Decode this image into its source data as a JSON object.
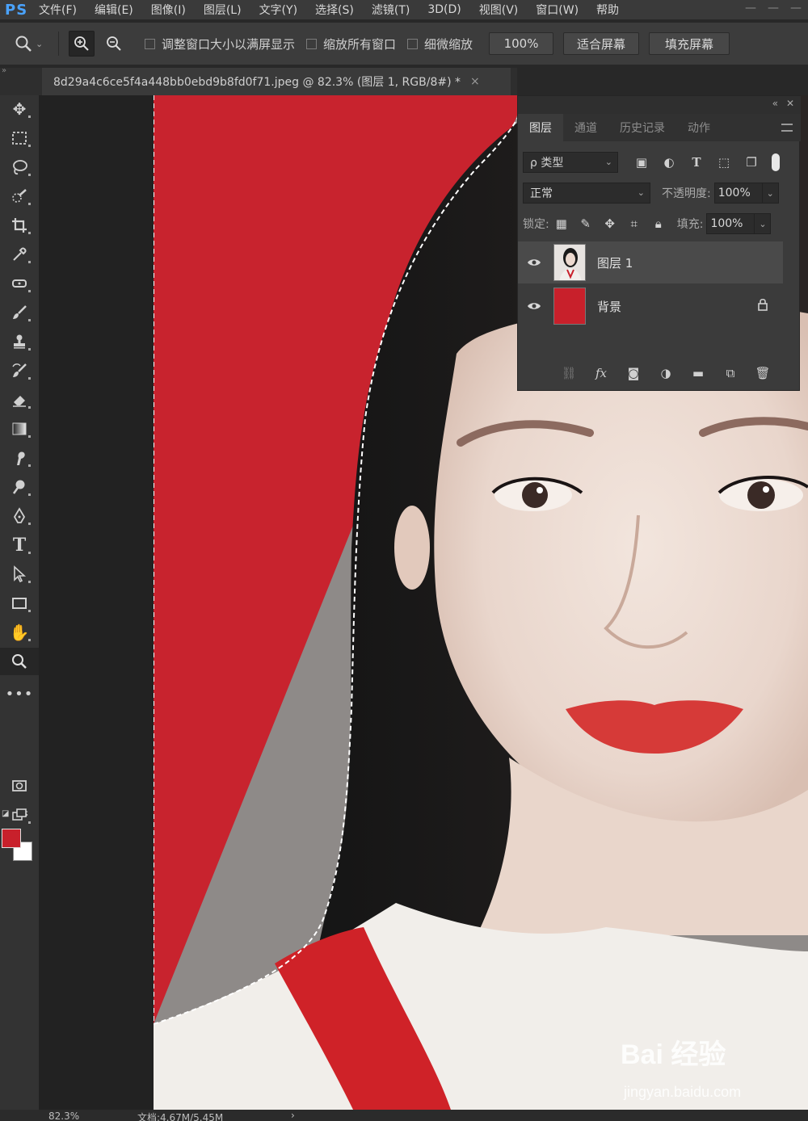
{
  "app": {
    "logo": "PS"
  },
  "menu": [
    "文件(F)",
    "编辑(E)",
    "图像(I)",
    "图层(L)",
    "文字(Y)",
    "选择(S)",
    "滤镜(T)",
    "3D(D)",
    "视图(V)",
    "窗口(W)",
    "帮助"
  ],
  "options": {
    "check_resize": "调整窗口大小以满屏显示",
    "check_zoom_all": "缩放所有窗口",
    "check_scrubby": "细微缩放",
    "zoom_value": "100%",
    "fit_screen": "适合屏幕",
    "fill_screen": "填充屏幕"
  },
  "document": {
    "tab_title": "8d29a4c6ce5f4a448bb0ebd9b8fd0f71.jpeg @ 82.3% (图层 1, RGB/8#) *",
    "close": "×"
  },
  "status": {
    "zoom": "82.3%",
    "doc_info": "文档:4.67M/5.45M",
    "arrow": "›"
  },
  "colors": {
    "foreground": "#c8202b",
    "background": "#ffffff",
    "canvas_red": "#c8232e"
  },
  "layers_panel": {
    "tabs": [
      "图层",
      "通道",
      "历史记录",
      "动作"
    ],
    "active_tab": 0,
    "kind_filter": "ρ 类型",
    "blend_mode": "正常",
    "opacity_label": "不透明度:",
    "opacity_value": "100%",
    "lock_label": "锁定:",
    "fill_label": "填充:",
    "fill_value": "100%",
    "layers": [
      {
        "name": "图层 1",
        "selected": true,
        "visible": true,
        "locked": false,
        "thumb": "portrait"
      },
      {
        "name": "背景",
        "selected": false,
        "visible": true,
        "locked": true,
        "thumb": "red-fill"
      }
    ]
  },
  "watermark": {
    "brand": "Bai 经验",
    "url": "jingyan.baidu.com"
  }
}
